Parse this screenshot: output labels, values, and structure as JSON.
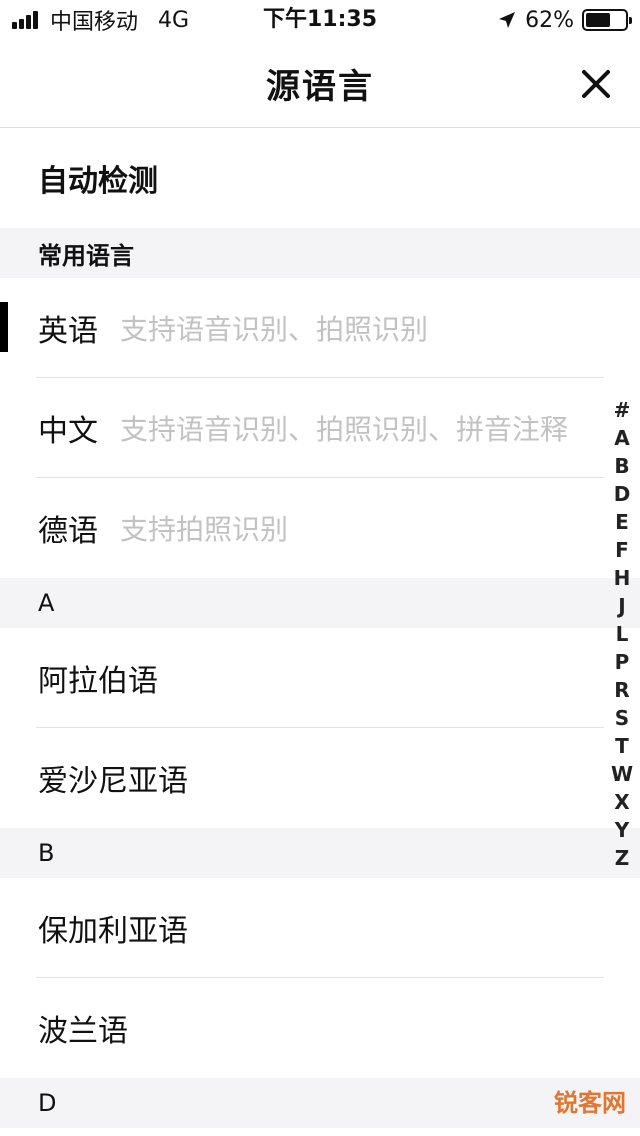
{
  "status_bar": {
    "carrier": "中国移动",
    "network": "4G",
    "time": "下午11:35",
    "battery_percent": "62%",
    "battery_level": 0.62
  },
  "nav": {
    "title": "源语言",
    "close_icon": "close-icon"
  },
  "auto_detect": "自动检测",
  "sections": {
    "common": {
      "header": "常用语言",
      "items": [
        {
          "name": "英语",
          "hint": "支持语音识别、拍照识别"
        },
        {
          "name": "中文",
          "hint": "支持语音识别、拍照识别、拼音注释"
        },
        {
          "name": "德语",
          "hint": "支持拍照识别"
        }
      ]
    },
    "A": {
      "header": "A",
      "items": [
        {
          "name": "阿拉伯语"
        },
        {
          "name": "爱沙尼亚语"
        }
      ]
    },
    "B": {
      "header": "B",
      "items": [
        {
          "name": "保加利亚语"
        },
        {
          "name": "波兰语"
        }
      ]
    },
    "D": {
      "header": "D"
    }
  },
  "index_letters": [
    "#",
    "A",
    "B",
    "D",
    "E",
    "F",
    "H",
    "J",
    "L",
    "P",
    "R",
    "S",
    "T",
    "W",
    "X",
    "Y",
    "Z"
  ],
  "watermark": "锐客网"
}
